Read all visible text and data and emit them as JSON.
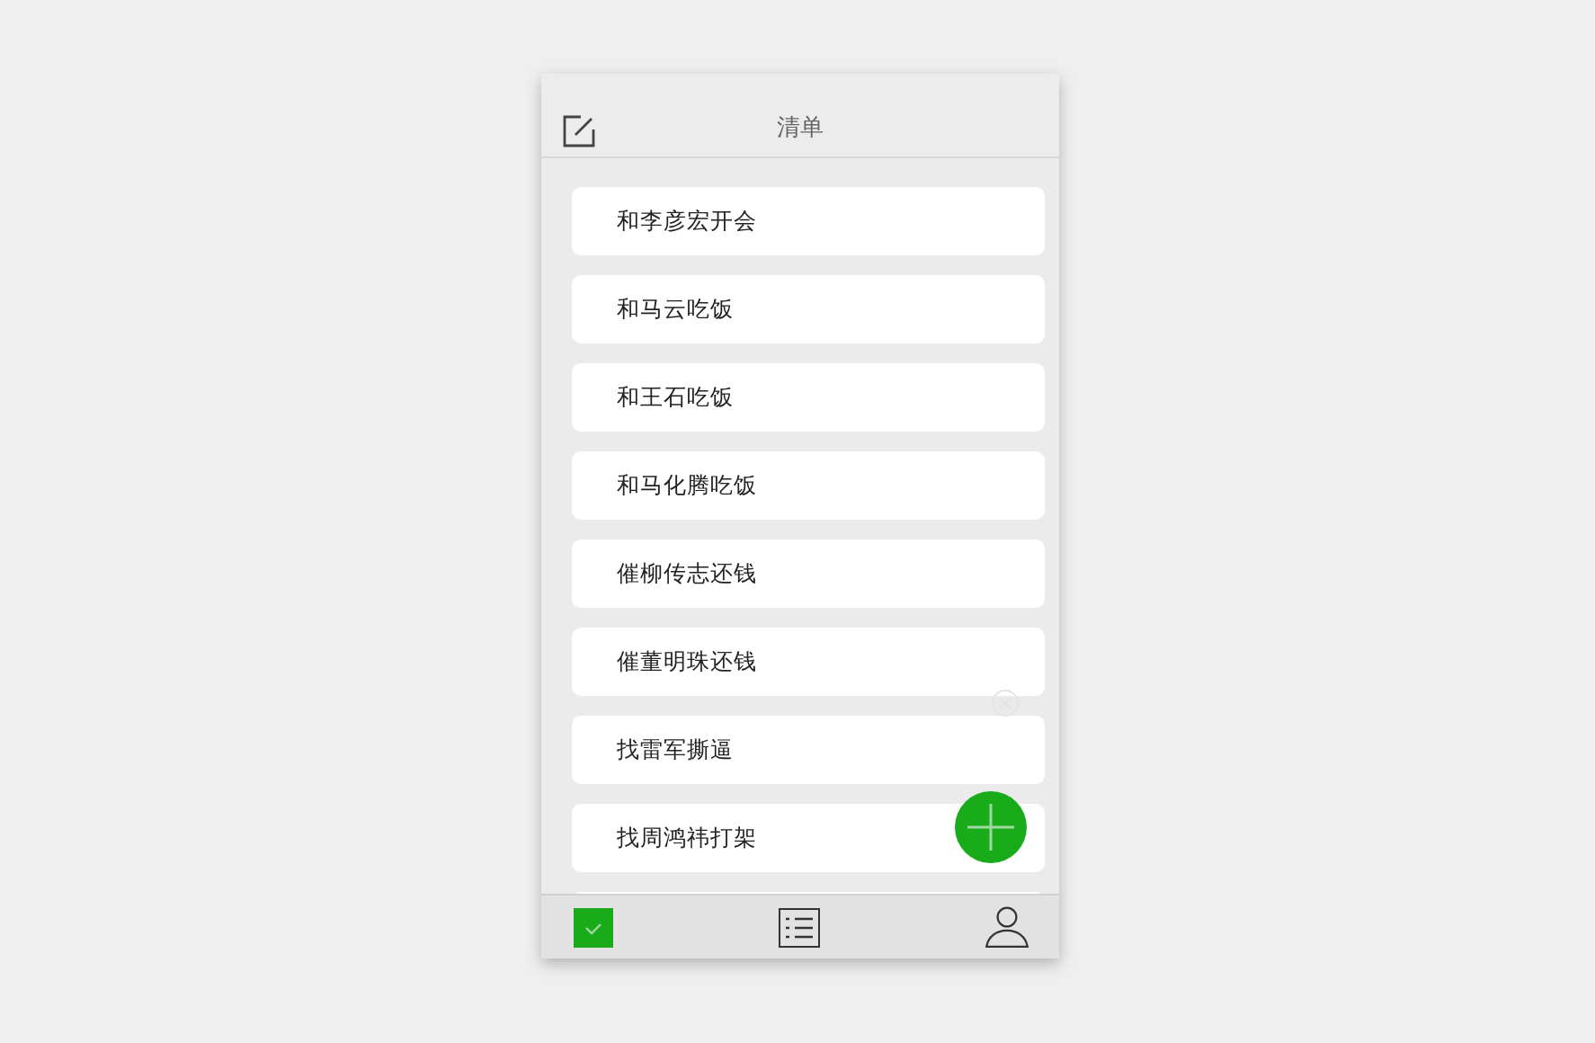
{
  "header": {
    "title": "清单"
  },
  "items": [
    {
      "text": "和李彦宏开会"
    },
    {
      "text": "和马云吃饭"
    },
    {
      "text": "和王石吃饭"
    },
    {
      "text": "和马化腾吃饭"
    },
    {
      "text": "催柳传志还钱"
    },
    {
      "text": "催董明珠还钱"
    },
    {
      "text": "找雷军撕逼"
    },
    {
      "text": "找周鸿祎打架"
    }
  ],
  "tabs": [
    {
      "kind": "todo",
      "selected": true
    },
    {
      "kind": "list",
      "selected": false
    },
    {
      "kind": "profile",
      "selected": false
    }
  ]
}
